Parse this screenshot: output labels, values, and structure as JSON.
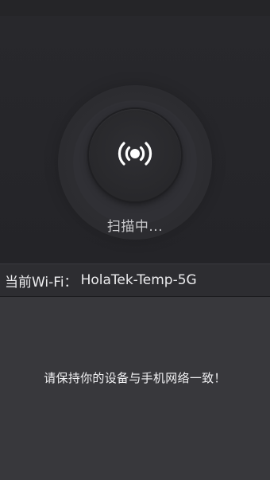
{
  "scan": {
    "icon": "broadcast-icon",
    "status": "扫描中..."
  },
  "wifi": {
    "label": "当前Wi-Fi：",
    "ssid": "HolaTek-Temp-5G"
  },
  "hint": {
    "text": "请保持你的设备与手机网络一致！"
  }
}
